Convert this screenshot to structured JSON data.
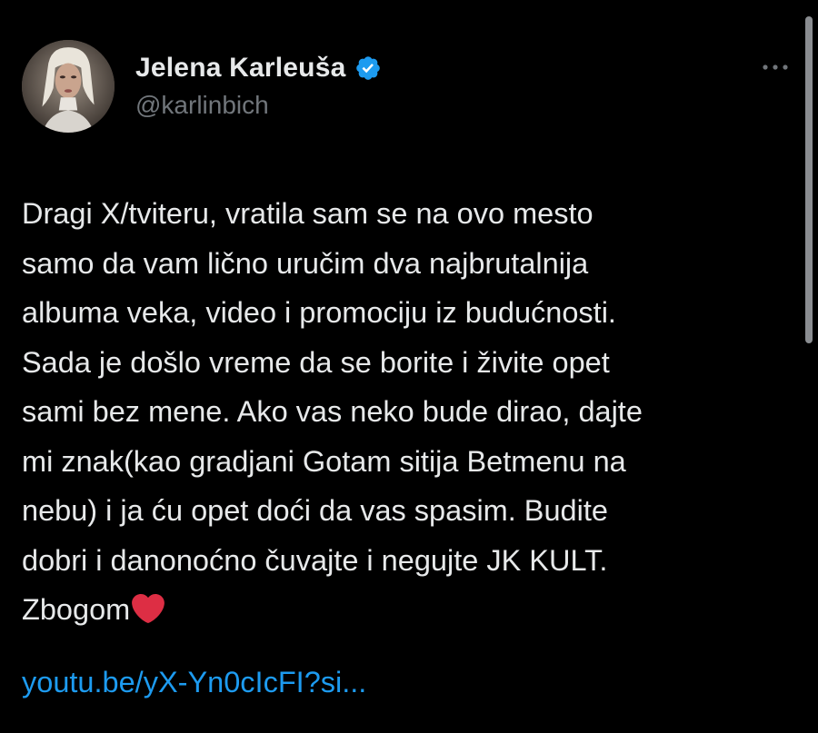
{
  "tweet": {
    "author": {
      "display_name": "Jelena Karleuša",
      "handle": "@karlinbich",
      "verified": true,
      "avatar_icon": "profile-photo"
    },
    "more_icon": "ellipsis-icon",
    "text": "Dragi X/tviteru, vratila sam se na ovo mesto\nsamo da vam lično uručim dva najbrutalnija\nalbuma veka, video i promociju iz budućnosti.\nSada je došlo vreme da se borite i živite opet\nsami bez mene. Ako vas neko bude dirao, dajte\nmi znak(kao gradjani Gotam sitija Betmenu na\nnebu) i ja ću opet doći da vas spasim. Budite\ndobri i danonoćno čuvajte i negujte JK KULT.\nZbogom",
    "emoji": "red-heart-icon",
    "link": "youtu.be/yX-Yn0cIcFI?si..."
  },
  "colors": {
    "background": "#000000",
    "text": "#e7e9ea",
    "secondary": "#71767b",
    "link": "#1d9bf0",
    "verified": "#1d9bf0",
    "heart": "#e0245e"
  }
}
